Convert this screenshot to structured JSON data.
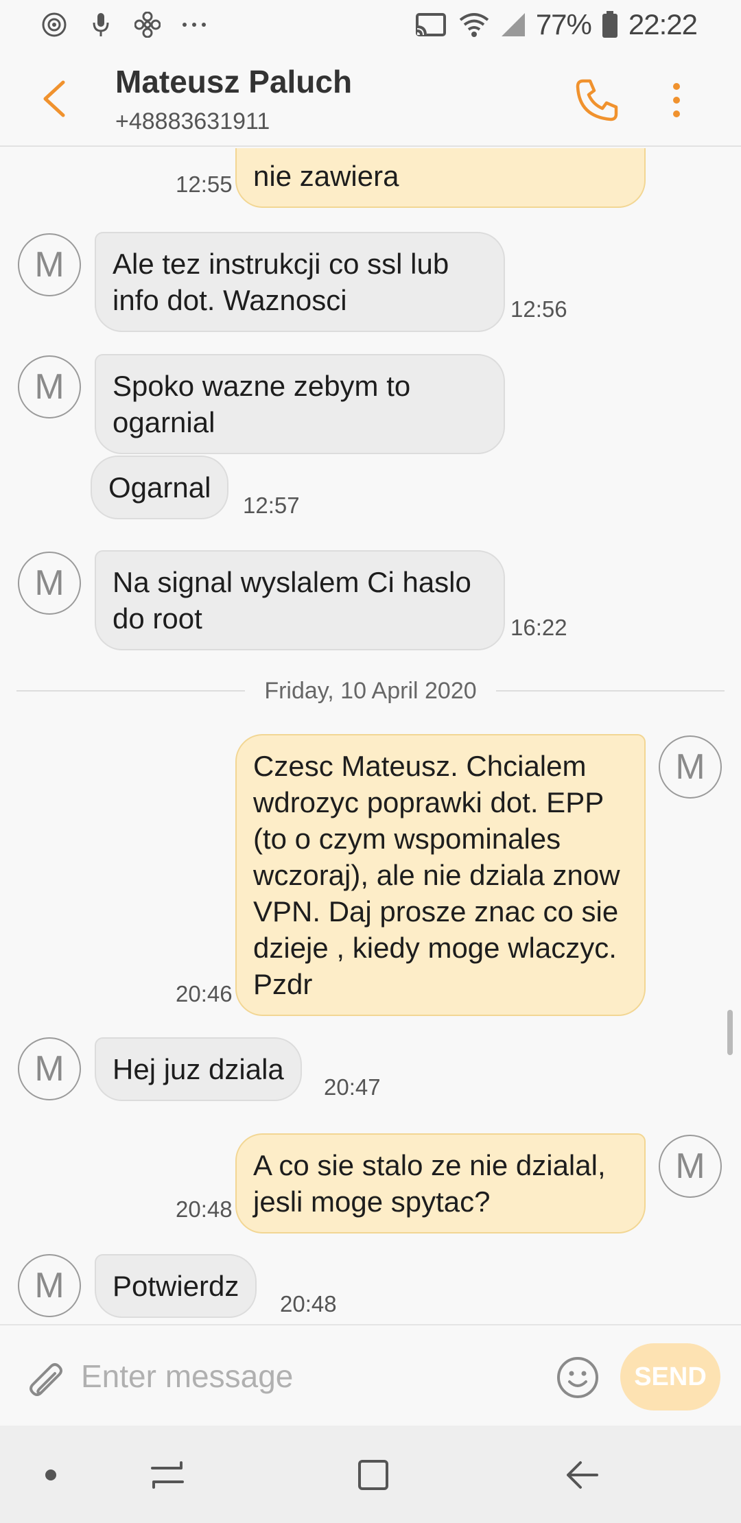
{
  "status_bar": {
    "battery_percent": "77%",
    "time": "22:22",
    "left_icons": [
      "camera-icon",
      "microphone-icon",
      "fan-icon",
      "more-dots-icon"
    ],
    "right_icons": [
      "cast-icon",
      "wifi-icon",
      "signal-icon",
      "battery-icon"
    ]
  },
  "header": {
    "contact_name": "Mateusz Paluch",
    "contact_number": "+48883631911"
  },
  "colors": {
    "accent": "#f0922e",
    "outgoing_bubble": "#fdedc8",
    "incoming_bubble": "#ececec",
    "send_button": "#fde2b2"
  },
  "conversation": {
    "avatar_initial": "M",
    "date_separator": "Friday, 10 April 2020",
    "messages": [
      {
        "direction": "out",
        "text": "nie zawiera",
        "time": "12:55"
      },
      {
        "direction": "in",
        "text": "Ale tez instrukcji co ssl lub info dot. Waznosci",
        "time": "12:56"
      },
      {
        "direction": "in",
        "text": "Spoko wazne zebym to ogarnial",
        "time": ""
      },
      {
        "direction": "in",
        "text": "Ogarnal",
        "time": "12:57"
      },
      {
        "direction": "in",
        "text": "Na signal wyslalem Ci haslo do root",
        "time": "16:22"
      },
      {
        "direction": "out",
        "text": "Czesc Mateusz. Chcialem wdrozyc poprawki dot. EPP (to o czym wspominales wczoraj), ale nie dziala znow VPN. Daj prosze znac co sie dzieje , kiedy moge wlaczyc. Pzdr",
        "time": "20:46"
      },
      {
        "direction": "in",
        "text": "Hej juz dziala",
        "time": "20:47"
      },
      {
        "direction": "out",
        "text": "A co sie stalo ze nie dzialal, jesli moge spytac?",
        "time": "20:48"
      },
      {
        "direction": "in",
        "text": "Potwierdz",
        "time": "20:48"
      }
    ]
  },
  "composer": {
    "placeholder": "Enter message",
    "send_label": "SEND"
  },
  "nav_bar": {
    "buttons": [
      "home-dot-icon",
      "recent-apps-icon",
      "home-square-icon",
      "back-arrow-icon"
    ]
  }
}
